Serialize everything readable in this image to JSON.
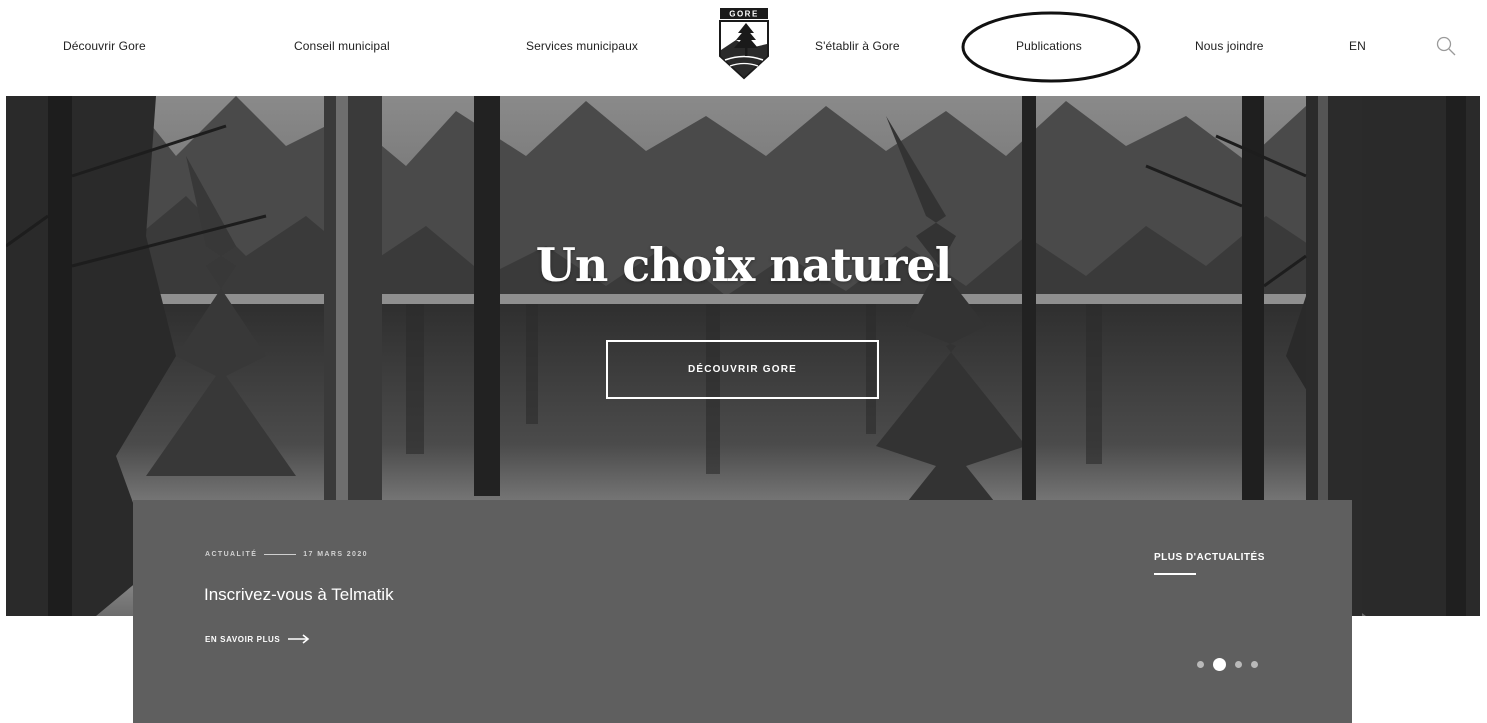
{
  "header": {
    "logo_text": "GORE",
    "nav_left": [
      "Découvrir Gore",
      "Conseil municipal",
      "Services municipaux"
    ],
    "nav_right": [
      "S'établir à Gore",
      "Publications",
      "Nous joindre"
    ],
    "language": "EN",
    "search_icon": "search-icon"
  },
  "hero": {
    "title": "Un choix naturel",
    "button_label": "DÉCOUVRIR GORE"
  },
  "news": {
    "category": "ACTUALITÉ",
    "date": "17 MARS 2020",
    "title": "Inscrivez-vous à Telmatik",
    "read_more": "EN SAVOIR PLUS",
    "more_news": "PLUS D'ACTUALITÉS",
    "slide_count": 4,
    "active_slide": 2
  },
  "colors": {
    "panel": "#5f5f5f",
    "text_dark": "#222222",
    "text_light": "#ffffff"
  }
}
